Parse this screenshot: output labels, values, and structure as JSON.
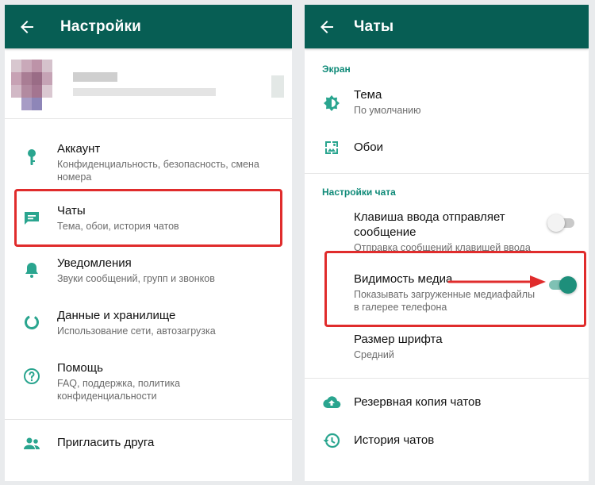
{
  "left": {
    "title": "Настройки",
    "items": [
      {
        "label": "Аккаунт",
        "sub": "Конфиденциальность, безопасность, смена номера"
      },
      {
        "label": "Чаты",
        "sub": "Тема, обои, история чатов"
      },
      {
        "label": "Уведомления",
        "sub": "Звуки сообщений, групп и звонков"
      },
      {
        "label": "Данные и хранилище",
        "sub": "Использование сети, автозагрузка"
      },
      {
        "label": "Помощь",
        "sub": "FAQ, поддержка, политика конфиденциальности"
      },
      {
        "label": "Пригласить друга"
      }
    ]
  },
  "right": {
    "title": "Чаты",
    "section_display": "Экран",
    "theme": {
      "label": "Тема",
      "sub": "По умолчанию"
    },
    "wallpaper": {
      "label": "Обои"
    },
    "section_chat": "Настройки чата",
    "enter_key": {
      "label": "Клавиша ввода отправляет сообщение",
      "sub": "Отправка сообщений клавишей ввода",
      "enabled": false
    },
    "media_visibility": {
      "label": "Видимость медиа",
      "sub": "Показывать загруженные медиафайлы в галерее телефона",
      "enabled": true
    },
    "font_size": {
      "label": "Размер шрифта",
      "sub": "Средний"
    },
    "backup": {
      "label": "Резервная копия чатов"
    },
    "history": {
      "label": "История чатов"
    }
  },
  "colors": {
    "appbar": "#075e54",
    "accent": "#0f8a78",
    "icon": "#2aa58f",
    "highlight": "#e02c2c"
  }
}
